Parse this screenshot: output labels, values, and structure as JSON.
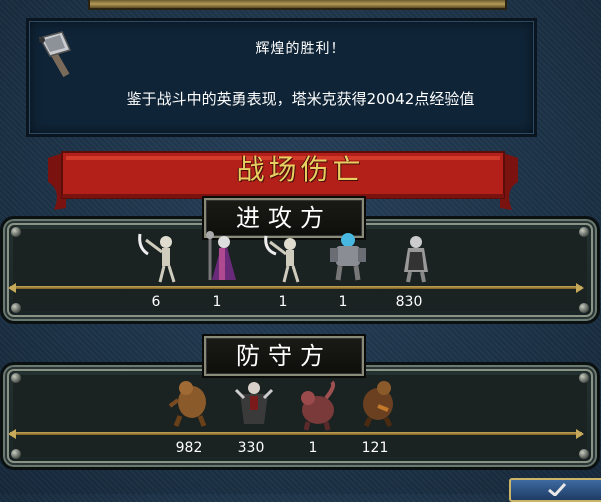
{
  "message": {
    "title": "辉煌的胜利！",
    "body": "鉴于战斗中的英勇表现，塔米克获得20042点经验值",
    "icon": "battle-axe-icon"
  },
  "banner": {
    "title": "战场伤亡"
  },
  "attacker": {
    "label": "进攻方",
    "units": [
      {
        "icon": "skeleton-warrior-icon",
        "count": "6"
      },
      {
        "icon": "lich-icon",
        "count": "1"
      },
      {
        "icon": "skeleton-icon",
        "count": "1"
      },
      {
        "icon": "armored-knight-icon",
        "count": "1"
      },
      {
        "icon": "dark-knight-icon",
        "count": "830"
      }
    ]
  },
  "defender": {
    "label": "防守方",
    "units": [
      {
        "icon": "troglodyte-icon",
        "count": "982"
      },
      {
        "icon": "vampire-icon",
        "count": "330"
      },
      {
        "icon": "manticore-icon",
        "count": "1"
      },
      {
        "icon": "beast-icon",
        "count": "121"
      }
    ]
  },
  "ok_button": {
    "icon": "checkmark-icon"
  },
  "colors": {
    "banner_red": "#b3201a",
    "gold": "#e8cf62",
    "panel": "#1a2222"
  }
}
